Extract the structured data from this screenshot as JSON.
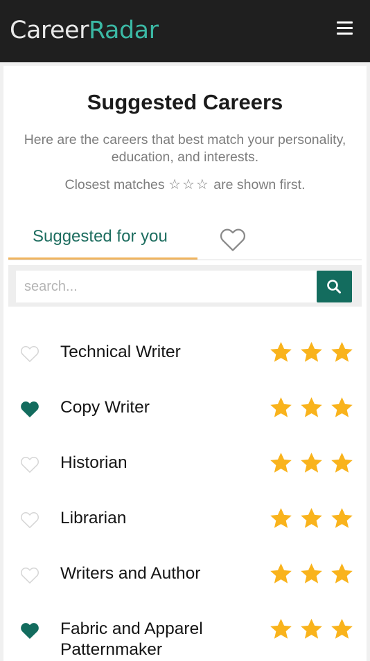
{
  "header": {
    "logo_part1": "Career",
    "logo_part2": "Radar"
  },
  "page": {
    "title": "Suggested Careers",
    "subtitle": "Here are the careers that best match your personality, education, and interests.",
    "note_prefix": "Closest matches",
    "note_stars": "☆☆☆",
    "note_suffix": "are shown first."
  },
  "tabs": {
    "suggested_label": "Suggested for you",
    "favorites_icon": "heart-outline-icon"
  },
  "search": {
    "placeholder": "search...",
    "value": "",
    "button_icon": "search-icon"
  },
  "colors": {
    "accent": "#136c5e",
    "tab_underline": "#f0b45e",
    "star": "#f9b31c",
    "heart_outline": "#d6d6d6"
  },
  "careers": [
    {
      "name": "Technical Writer",
      "favorited": false,
      "stars": 3
    },
    {
      "name": "Copy Writer",
      "favorited": true,
      "stars": 3
    },
    {
      "name": "Historian",
      "favorited": false,
      "stars": 3
    },
    {
      "name": "Librarian",
      "favorited": false,
      "stars": 3
    },
    {
      "name": "Writers and Author",
      "favorited": false,
      "stars": 3
    },
    {
      "name": "Fabric and Apparel Patternmaker",
      "favorited": true,
      "stars": 3
    }
  ]
}
